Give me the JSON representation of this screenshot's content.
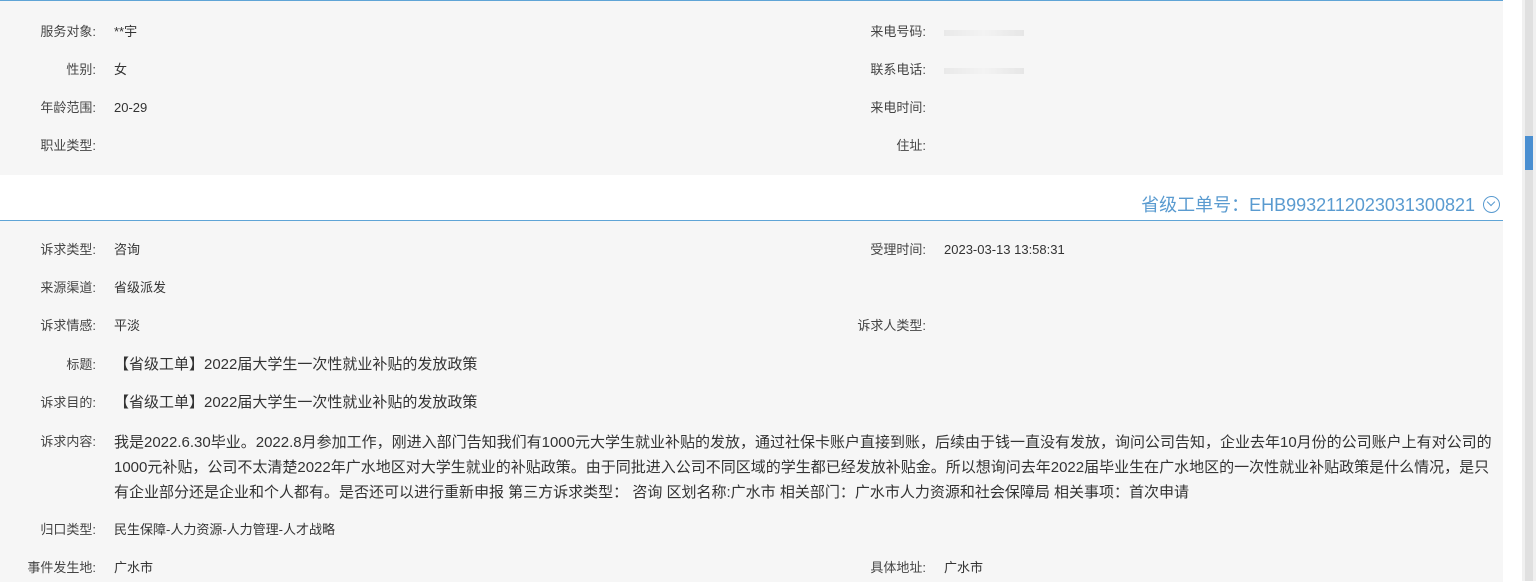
{
  "caller_info": {
    "service_target_label": "服务对象:",
    "service_target_value": "**宇",
    "gender_label": "性别:",
    "gender_value": "女",
    "age_range_label": "年龄范围:",
    "age_range_value": "20-29",
    "occupation_label": "职业类型:",
    "occupation_value": "",
    "incoming_number_label": "来电号码:",
    "contact_phone_label": "联系电话:",
    "call_time_label": "来电时间:",
    "call_time_value": "",
    "address_label": "住址:",
    "address_value": ""
  },
  "order_header": {
    "order_number_text": "省级工单号：EHB9932112023031300821"
  },
  "appeal": {
    "type_label": "诉求类型:",
    "type_value": "咨询",
    "accept_time_label": "受理时间:",
    "accept_time_value": "2023-03-13 13:58:31",
    "source_label": "来源渠道:",
    "source_value": "省级派发",
    "emotion_label": "诉求情感:",
    "emotion_value": "平淡",
    "appellant_type_label": "诉求人类型:",
    "appellant_type_value": "",
    "title_label": "标题:",
    "title_value": "【省级工单】2022届大学生一次性就业补贴的发放政策",
    "purpose_label": "诉求目的:",
    "purpose_value": "【省级工单】2022届大学生一次性就业补贴的发放政策",
    "content_label": "诉求内容:",
    "content_value": "我是2022.6.30毕业。2022.8月参加工作，刚进入部门告知我们有1000元大学生就业补贴的发放，通过社保卡账户直接到账，后续由于钱一直没有发放，询问公司告知，企业去年10月份的公司账户上有对公司的1000元补贴，公司不太清楚2022年广水地区对大学生就业的补贴政策。由于同批进入公司不同区域的学生都已经发放补贴金。所以想询问去年2022届毕业生在广水地区的一次性就业补贴政策是什么情况，是只有企业部分还是企业和个人都有。是否还可以进行重新申报 第三方诉求类型： 咨询 区划名称:广水市 相关部门：广水市人力资源和社会保障局 相关事项：首次申请",
    "category_label": "归口类型:",
    "category_value": "民生保障-人力资源-人力管理-人才战略",
    "location_label": "事件发生地:",
    "location_value": "广水市",
    "detail_address_label": "具体地址:",
    "detail_address_value": "广水市"
  }
}
